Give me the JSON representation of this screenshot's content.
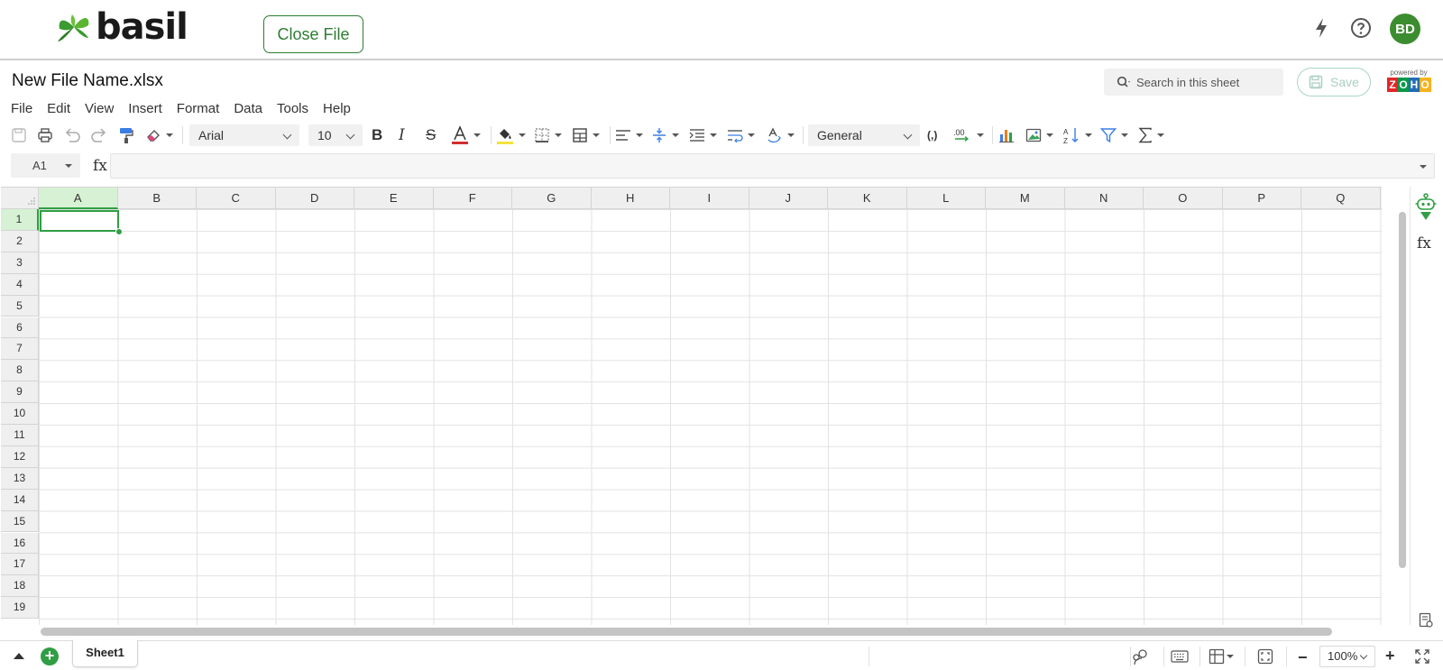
{
  "app": {
    "logo_text": "basil",
    "close_file_label": "Close File",
    "avatar_initials": "BD"
  },
  "sheet": {
    "file_name": "New File Name.xlsx",
    "search_placeholder": "Search in this sheet",
    "save_label": "Save",
    "powered_by": "powered by",
    "zoho_letters": [
      "Z",
      "O",
      "H",
      "O"
    ],
    "zoho_colors": [
      "#e42527",
      "#089949",
      "#226db4",
      "#f9b21d"
    ]
  },
  "menu": [
    "File",
    "Edit",
    "View",
    "Insert",
    "Format",
    "Data",
    "Tools",
    "Help"
  ],
  "toolbar": {
    "font_name": "Arial",
    "font_size": "10",
    "number_format": "General",
    "font_color": "#d32f2f",
    "fill_color": "#f5e23a",
    "chart_color": "#3c7ee6",
    "icons": [
      "save-icon",
      "print-icon",
      "undo-icon",
      "redo-icon",
      "format-painter-icon",
      "clear-format-icon",
      "bold-icon",
      "italic-icon",
      "strikethrough-icon",
      "font-color-icon",
      "fill-color-icon",
      "borders-icon",
      "merge-cells-icon",
      "align-left-icon",
      "vertical-align-icon",
      "indent-icon",
      "wrap-text-icon",
      "text-rotation-icon",
      "thousands-separator-icon",
      "decimal-icon",
      "chart-icon",
      "image-icon",
      "sort-icon",
      "filter-icon",
      "sum-icon"
    ]
  },
  "formula_bar": {
    "cell_ref": "A1",
    "fx_label": "fx",
    "value": ""
  },
  "grid": {
    "columns": [
      "A",
      "B",
      "C",
      "D",
      "E",
      "F",
      "G",
      "H",
      "I",
      "J",
      "K",
      "L",
      "M",
      "N",
      "O",
      "P",
      "Q"
    ],
    "rows": [
      "1",
      "2",
      "3",
      "4",
      "5",
      "6",
      "7",
      "8",
      "9",
      "10",
      "11",
      "12",
      "13",
      "14",
      "15",
      "16",
      "17",
      "18",
      "19"
    ],
    "active_column": "A",
    "active_row": "1",
    "accent": "#2f9e44"
  },
  "side_panel": {
    "fx_label": "fx"
  },
  "bottom": {
    "sheet_tab": "Sheet1",
    "add_label": "+",
    "zoom": "100%",
    "minus": "−",
    "plus": "+"
  }
}
